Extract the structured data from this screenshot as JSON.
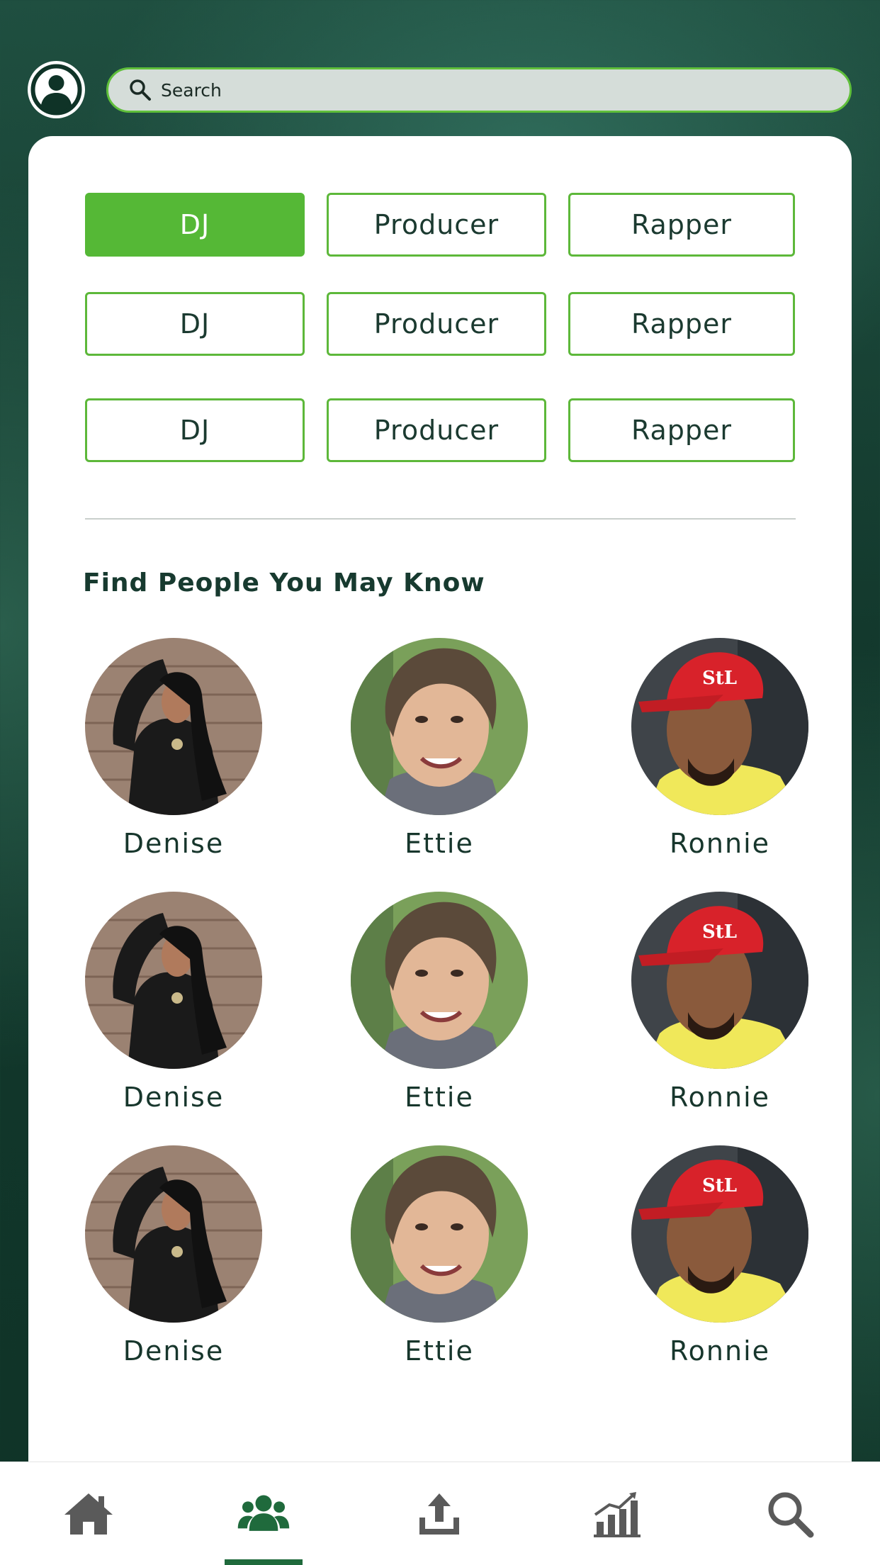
{
  "header": {
    "search_placeholder": "Search"
  },
  "filters": {
    "rows": [
      [
        "DJ",
        "Producer",
        "Rapper"
      ],
      [
        "DJ",
        "Producer",
        "Rapper"
      ],
      [
        "DJ",
        "Producer",
        "Rapper"
      ]
    ],
    "selected": "DJ",
    "accent_color": "#55b836"
  },
  "people_section": {
    "title": "Find People You May Know",
    "people": [
      {
        "name": "Denise"
      },
      {
        "name": "Ettie"
      },
      {
        "name": "Ronnie"
      },
      {
        "name": "Denise"
      },
      {
        "name": "Ettie"
      },
      {
        "name": "Ronnie"
      },
      {
        "name": "Denise"
      },
      {
        "name": "Ettie"
      },
      {
        "name": "Ronnie"
      }
    ]
  },
  "tabbar": {
    "tabs": [
      {
        "icon": "home-icon"
      },
      {
        "icon": "people-icon",
        "active": true
      },
      {
        "icon": "upload-icon"
      },
      {
        "icon": "stats-icon"
      },
      {
        "icon": "search-icon"
      }
    ],
    "active_color": "#1f6a3c",
    "inactive_color": "#5a5a5a"
  }
}
